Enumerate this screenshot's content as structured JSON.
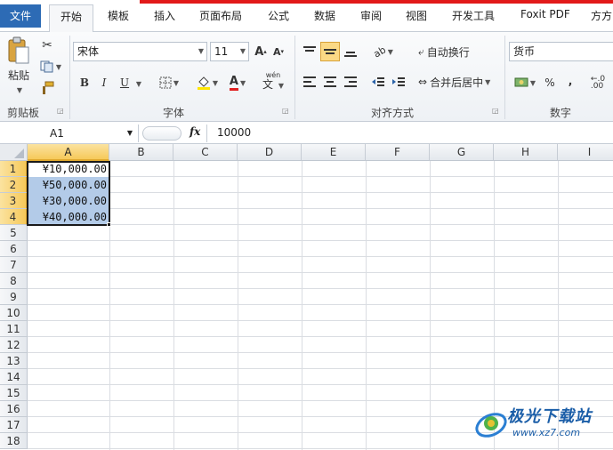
{
  "tabs": [
    "文件",
    "开始",
    "模板",
    "插入",
    "页面布局",
    "公式",
    "数据",
    "审阅",
    "视图",
    "开发工具",
    "Foxit PDF",
    "方方"
  ],
  "clipboard": {
    "paste_label": "粘贴",
    "group_label": "剪贴板"
  },
  "font": {
    "name": "宋体",
    "size": "11",
    "group_label": "字体",
    "bold": "B",
    "italic": "I",
    "underline": "U",
    "font_color_glyph": "A",
    "phonetic_glyph": "wén"
  },
  "alignment": {
    "wrap_label": "自动换行",
    "merge_label": "合并后居中",
    "group_label": "对齐方式"
  },
  "number": {
    "format": "货币",
    "percent": "%",
    "comma": ",",
    "group_label": "数字"
  },
  "formula_bar": {
    "cell_ref": "A1",
    "fx": "fx",
    "value": "10000"
  },
  "columns": [
    "A",
    "B",
    "C",
    "D",
    "E",
    "F",
    "G",
    "H",
    "I"
  ],
  "rows": [
    "1",
    "2",
    "3",
    "4",
    "5",
    "6",
    "7",
    "8",
    "9",
    "10",
    "11",
    "12",
    "13",
    "14",
    "15",
    "16",
    "17",
    "18"
  ],
  "cells": [
    {
      "ref": "A1",
      "value": "¥10,000.00"
    },
    {
      "ref": "A2",
      "value": "¥50,000.00"
    },
    {
      "ref": "A3",
      "value": "¥30,000.00"
    },
    {
      "ref": "A4",
      "value": "¥40,000.00"
    }
  ],
  "watermark": {
    "brand": "极光下载站",
    "url": "www.xz7.com"
  },
  "colors": {
    "file_tab": "#2d6bb5",
    "selection": "#b3cbe8",
    "header_selected": "#f6c95a",
    "top_bar": "#e21a1a"
  }
}
